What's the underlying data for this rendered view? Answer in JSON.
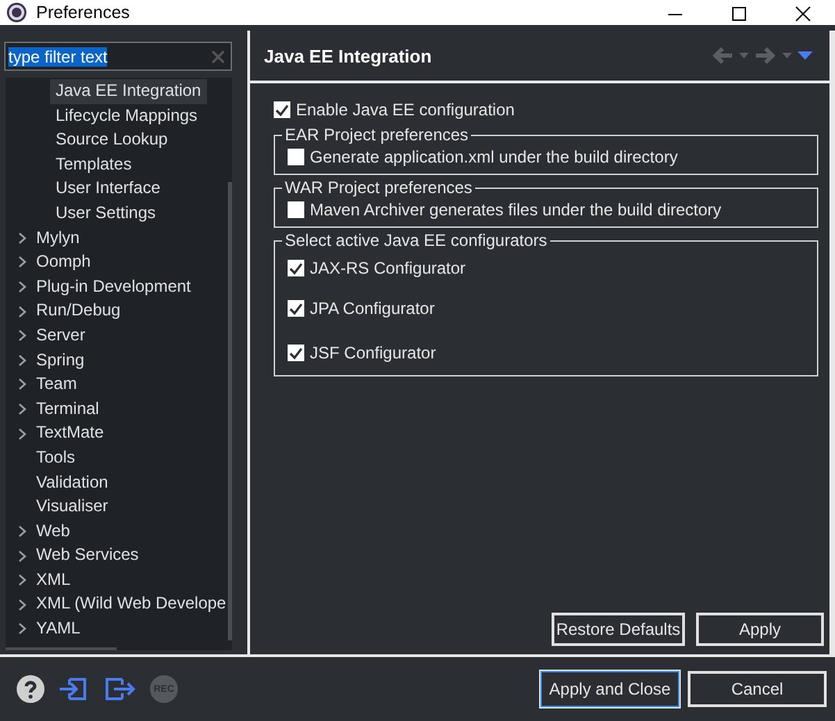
{
  "window": {
    "title": "Preferences"
  },
  "filter": {
    "value": "type filter text"
  },
  "tree": {
    "nested_items": [
      {
        "label": "Java EE Integration",
        "selected": true
      },
      {
        "label": "Lifecycle Mappings",
        "selected": false
      },
      {
        "label": "Source Lookup",
        "selected": false
      },
      {
        "label": "Templates",
        "selected": false
      },
      {
        "label": "User Interface",
        "selected": false
      },
      {
        "label": "User Settings",
        "selected": false
      }
    ],
    "items": [
      {
        "label": "Mylyn",
        "expandable": true,
        "selected": false
      },
      {
        "label": "Oomph",
        "expandable": true,
        "selected": false
      },
      {
        "label": "Plug-in Development",
        "expandable": true,
        "selected": false
      },
      {
        "label": "Run/Debug",
        "expandable": true,
        "selected": false
      },
      {
        "label": "Server",
        "expandable": true,
        "selected": false
      },
      {
        "label": "Spring",
        "expandable": true,
        "selected": false
      },
      {
        "label": "Team",
        "expandable": true,
        "selected": false
      },
      {
        "label": "Terminal",
        "expandable": true,
        "selected": false
      },
      {
        "label": "TextMate",
        "expandable": true,
        "selected": false
      },
      {
        "label": "Tools",
        "expandable": false,
        "selected": false
      },
      {
        "label": "Validation",
        "expandable": false,
        "selected": false
      },
      {
        "label": "Visualiser",
        "expandable": false,
        "selected": false
      },
      {
        "label": "Web",
        "expandable": true,
        "selected": false
      },
      {
        "label": "Web Services",
        "expandable": true,
        "selected": false
      },
      {
        "label": "XML",
        "expandable": true,
        "selected": false
      },
      {
        "label": "XML (Wild Web Develope",
        "expandable": true,
        "selected": false
      },
      {
        "label": "YAML",
        "expandable": true,
        "selected": false
      }
    ]
  },
  "page": {
    "title": "Java EE Integration",
    "enable": {
      "label": "Enable Java EE configuration",
      "checked": true
    },
    "groups": [
      {
        "title": "EAR Project preferences",
        "options": [
          {
            "label": "Generate application.xml under the build directory",
            "checked": false
          }
        ]
      },
      {
        "title": "WAR Project preferences",
        "options": [
          {
            "label": "Maven Archiver generates files under the build directory",
            "checked": false
          }
        ]
      },
      {
        "title": "Select active Java EE configurators",
        "spacious": true,
        "options": [
          {
            "label": "JAX-RS Configurator",
            "checked": true
          },
          {
            "label": "JPA Configurator",
            "checked": true
          },
          {
            "label": "JSF Configurator",
            "checked": true
          }
        ]
      }
    ],
    "buttons": [
      "Restore Defaults",
      "Apply"
    ]
  },
  "footer": {
    "rec_label": "REC",
    "buttons": [
      {
        "label": "Apply and Close",
        "default": true
      },
      {
        "label": "Cancel",
        "default": false
      }
    ]
  }
}
